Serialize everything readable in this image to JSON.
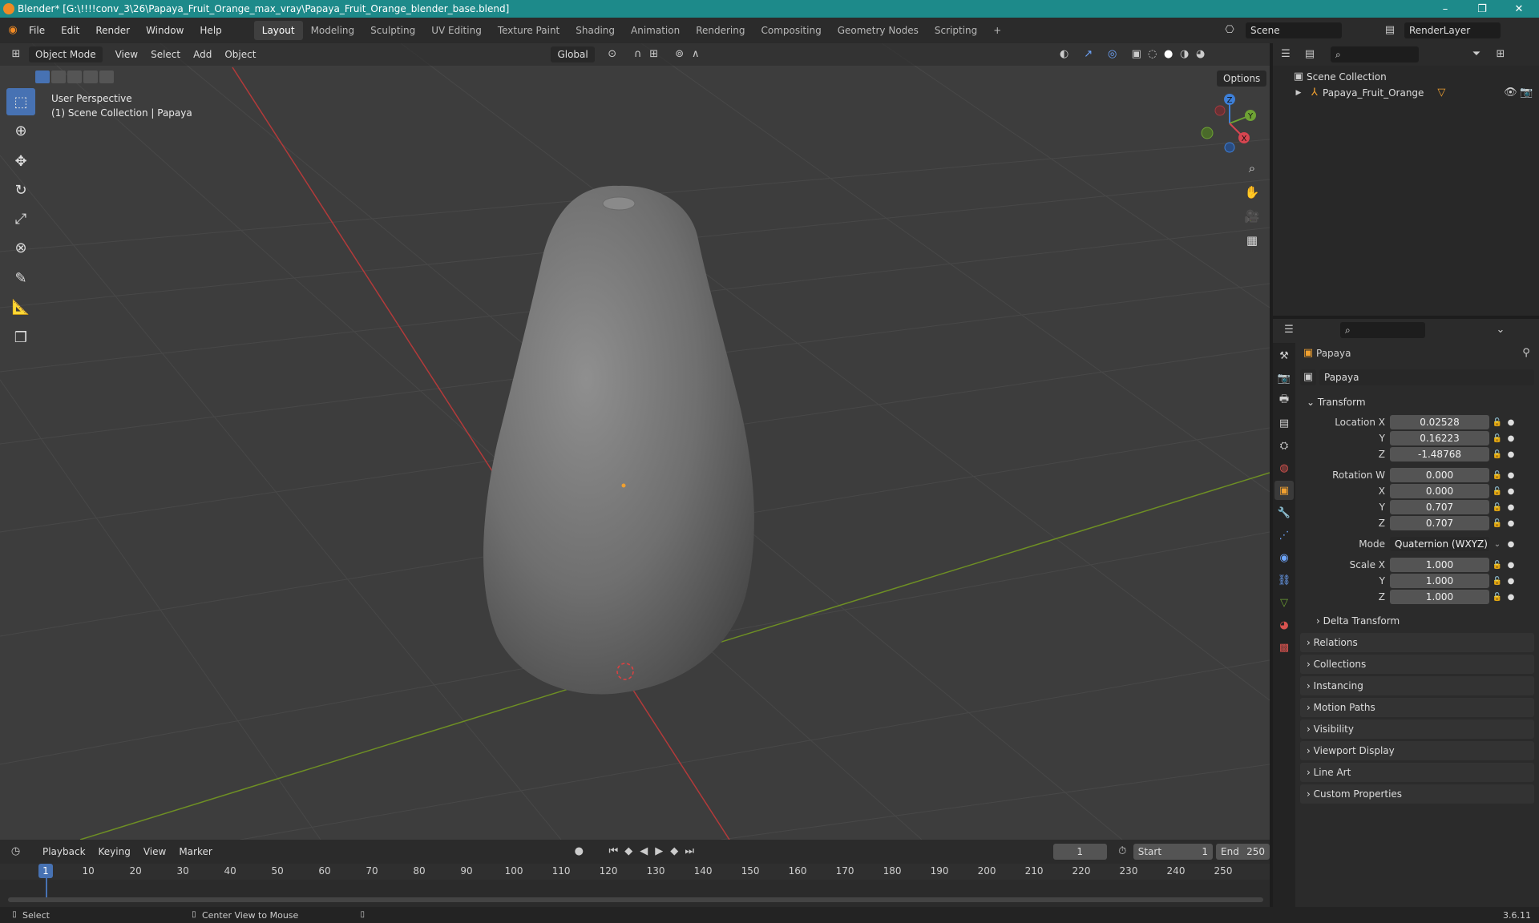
{
  "window": {
    "title": "Blender* [G:\\!!!!conv_3\\26\\Papaya_Fruit_Orange_max_vray\\Papaya_Fruit_Orange_blender_base.blend]",
    "minimize": "–",
    "maximize": "❐",
    "close": "✕"
  },
  "menu": {
    "items": [
      "File",
      "Edit",
      "Render",
      "Window",
      "Help"
    ],
    "workspaces": [
      "Layout",
      "Modeling",
      "Sculpting",
      "UV Editing",
      "Texture Paint",
      "Shading",
      "Animation",
      "Rendering",
      "Compositing",
      "Geometry Nodes",
      "Scripting"
    ],
    "add_workspace": "+",
    "scene": "Scene",
    "view_layer": "RenderLayer"
  },
  "viewport": {
    "mode": "Object Mode",
    "menus": [
      "View",
      "Select",
      "Add",
      "Object"
    ],
    "orientation": "Global",
    "options": "Options",
    "info_line1": "User Perspective",
    "info_line2": "(1) Scene Collection | Papaya",
    "gizmo": {
      "z": "Z",
      "y": "Y",
      "x": "X"
    }
  },
  "outliner": {
    "root": "Scene Collection",
    "object": "Papaya_Fruit_Orange"
  },
  "properties": {
    "object_name": "Papaya",
    "data_name": "Papaya",
    "transform_header": "Transform",
    "location_label": "Location X",
    "location": {
      "x": "0.02528",
      "y": "0.16223",
      "z": "-1.48768"
    },
    "rotation_label": "Rotation W",
    "rotation": {
      "w": "0.000",
      "x": "0.000",
      "y": "0.707",
      "z": "0.707"
    },
    "mode_label": "Mode",
    "mode_value": "Quaternion (WXYZ)",
    "scale_label": "Scale X",
    "scale": {
      "x": "1.000",
      "y": "1.000",
      "z": "1.000"
    },
    "axis_y": "Y",
    "axis_z": "Z",
    "axis_x": "X",
    "delta": "Delta Transform",
    "panels": [
      "Relations",
      "Collections",
      "Instancing",
      "Motion Paths",
      "Visibility",
      "Viewport Display",
      "Line Art",
      "Custom Properties"
    ]
  },
  "timeline": {
    "menus": [
      "Playback",
      "Keying",
      "View",
      "Marker"
    ],
    "current_frame": "1",
    "start_label": "Start",
    "start": "1",
    "end_label": "End",
    "end": "250",
    "ticks": [
      "1",
      "10",
      "20",
      "30",
      "40",
      "50",
      "60",
      "70",
      "80",
      "90",
      "100",
      "110",
      "120",
      "130",
      "140",
      "150",
      "160",
      "170",
      "180",
      "190",
      "200",
      "210",
      "220",
      "230",
      "240",
      "250"
    ]
  },
  "status": {
    "select": "Select",
    "center_view": "Center View to Mouse",
    "version": "3.6.11"
  }
}
